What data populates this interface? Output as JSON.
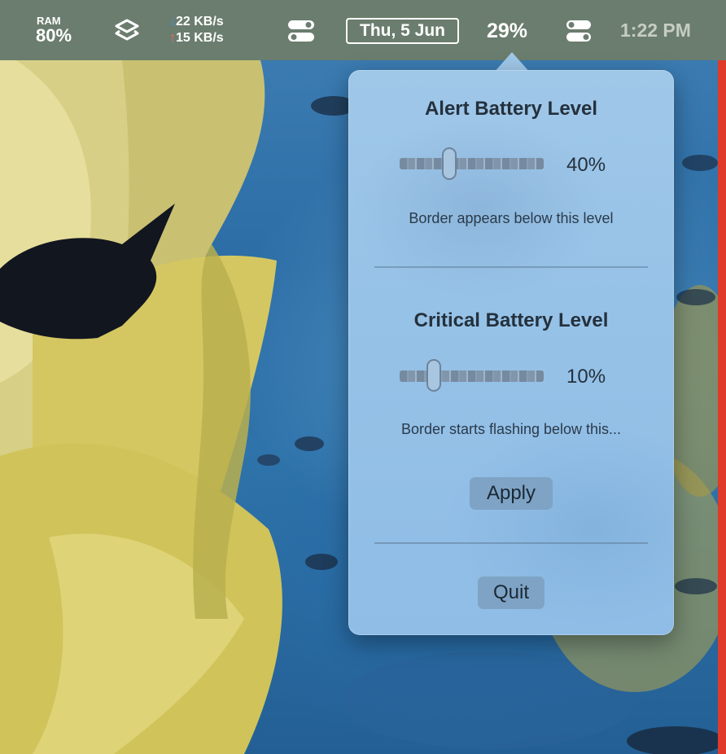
{
  "menubar": {
    "ram_label": "RAM",
    "ram_value": "80%",
    "net_down_arrow": "↓",
    "net_down": "22 KB/s",
    "net_up_arrow": "↑",
    "net_up": "15 KB/s",
    "date": "Thu, 5 Jun",
    "battery_percent": "29%",
    "clock": "1:22 PM",
    "icons": [
      "layers-icon",
      "toggle-switch-icon",
      "toggle-switch-icon"
    ]
  },
  "popover": {
    "alert": {
      "title": "Alert Battery Level",
      "value_label": "40%",
      "value": 40,
      "caption": "Border appears below this level"
    },
    "critical": {
      "title": "Critical Battery Level",
      "value_label": "10%",
      "value": 10,
      "caption": "Border starts flashing below this..."
    },
    "apply_label": "Apply",
    "quit_label": "Quit"
  },
  "colors": {
    "menubar_bg": "#6b7d6e",
    "popover_bg": "#97c2e7",
    "button_bg": "#7ea3c4",
    "border_alert": "#e03a2a",
    "net_down_arrow": "#3a8ff0",
    "net_up_arrow": "#f06a5a"
  }
}
